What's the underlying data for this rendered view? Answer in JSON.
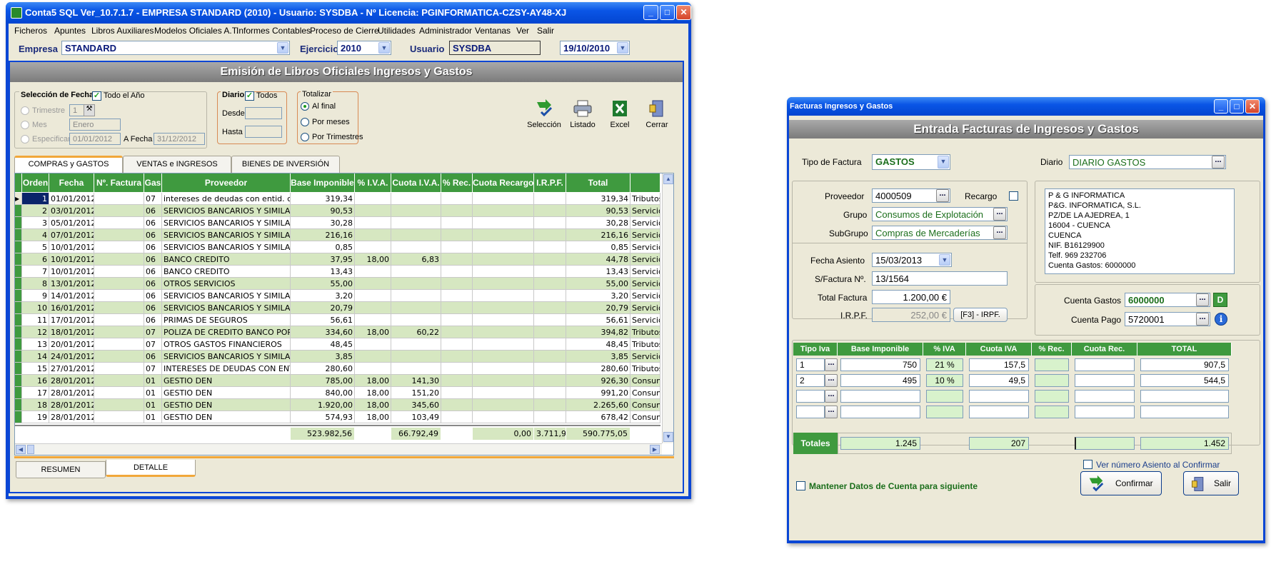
{
  "main_window": {
    "title": "Conta5 SQL Ver_10.7.1.7  -  EMPRESA STANDARD  (2010)  -   Usuario:  SYSDBA   -   Nº Licencia:  PGINFORMATICA-CZSY-AY48-XJ",
    "menu": [
      "Ficheros",
      "Apuntes",
      "Libros Auxiliares",
      "Modelos Oficiales A.T.",
      "Informes Contables",
      "Proceso de Cierre",
      "Utilidades",
      "Administrador",
      "Ventanas",
      "Ver",
      "Salir"
    ],
    "empresa_label": "Empresa",
    "empresa_value": "STANDARD",
    "ejercicio_label": "Ejercicio",
    "ejercicio_value": "2010",
    "usuario_label": "Usuario",
    "usuario_value": "SYSDBA",
    "date_value": "19/10/2010",
    "section_title": "Emisión de Libros Oficiales Ingresos y Gastos",
    "fechas": {
      "title": "Selección de Fechas",
      "todo_ano": "Todo el Año",
      "trimestre": "Trimestre",
      "trimestre_val": "1",
      "mes": "Mes",
      "mes_val": "Enero",
      "especificar": "Especificar",
      "desde_val": "01/01/2012",
      "a_fecha": "A Fecha",
      "hasta_val": "31/12/2012"
    },
    "diario": {
      "title": "Diario",
      "todos": "Todos",
      "desde": "Desde",
      "hasta": "Hasta"
    },
    "totalizar": {
      "title": "Totalizar",
      "al_final": "Al final",
      "por_meses": "Por meses",
      "por_trimestres": "Por Trimestres"
    },
    "toolbar": {
      "seleccion": "Selección",
      "listado": "Listado",
      "excel": "Excel",
      "cerrar": "Cerrar"
    },
    "tabs": [
      "COMPRAS y GASTOS",
      "VENTAS e INGRESOS",
      "BIENES DE INVERSIÓN"
    ],
    "table": {
      "headers": [
        "Orden",
        "Fecha",
        "Nº. Factura",
        "Gas",
        "Proveedor",
        "Base Imponible",
        "% I.V.A.",
        "Cuota I.V.A.",
        "% Rec.",
        "Cuota Recargo",
        "I.R.P.F.",
        "Total",
        ""
      ],
      "rows": [
        [
          "1",
          "01/01/2012",
          "",
          "07",
          "intereses de deudas con entid. cred.",
          "319,34",
          "",
          "",
          "",
          "",
          "",
          "319,34",
          "Tributos"
        ],
        [
          "2",
          "03/01/2012",
          "",
          "06",
          "SERVICIOS BANCARIOS Y SIMILARES",
          "90,53",
          "",
          "",
          "",
          "",
          "",
          "90,53",
          "Servicio"
        ],
        [
          "3",
          "05/01/2012",
          "",
          "06",
          "SERVICIOS BANCARIOS Y SIMILARES",
          "30,28",
          "",
          "",
          "",
          "",
          "",
          "30,28",
          "Servicio"
        ],
        [
          "4",
          "07/01/2012",
          "",
          "06",
          "SERVICIOS BANCARIOS Y SIMILARES",
          "216,16",
          "",
          "",
          "",
          "",
          "",
          "216,16",
          "Servicio"
        ],
        [
          "5",
          "10/01/2012",
          "",
          "06",
          "SERVICIOS BANCARIOS Y SIMILARES",
          "0,85",
          "",
          "",
          "",
          "",
          "",
          "0,85",
          "Servicio"
        ],
        [
          "6",
          "10/01/2012",
          "",
          "06",
          "BANCO CREDITO",
          "37,95",
          "18,00",
          "6,83",
          "",
          "",
          "",
          "44,78",
          "Servicio"
        ],
        [
          "7",
          "10/01/2012",
          "",
          "06",
          "BANCO CREDITO",
          "13,43",
          "",
          "",
          "",
          "",
          "",
          "13,43",
          "Servicio"
        ],
        [
          "8",
          "13/01/2012",
          "",
          "06",
          "OTROS SERVICIOS",
          "55,00",
          "",
          "",
          "",
          "",
          "",
          "55,00",
          "Servicio"
        ],
        [
          "9",
          "14/01/2012",
          "",
          "06",
          "SERVICIOS BANCARIOS Y SIMILARES",
          "3,20",
          "",
          "",
          "",
          "",
          "",
          "3,20",
          "Servicio"
        ],
        [
          "10",
          "16/01/2012",
          "",
          "06",
          "SERVICIOS BANCARIOS Y SIMILARES",
          "20,79",
          "",
          "",
          "",
          "",
          "",
          "20,79",
          "Servicio"
        ],
        [
          "11",
          "17/01/2012",
          "",
          "06",
          "PRIMAS DE SEGUROS",
          "56,61",
          "",
          "",
          "",
          "",
          "",
          "56,61",
          "Servicio"
        ],
        [
          "12",
          "18/01/2012",
          "",
          "07",
          "POLIZA DE CREDITO BANCO POPULAR",
          "334,60",
          "18,00",
          "60,22",
          "",
          "",
          "",
          "394,82",
          "Tributos"
        ],
        [
          "13",
          "20/01/2012",
          "",
          "07",
          "OTROS GASTOS FINANCIEROS",
          "48,45",
          "",
          "",
          "",
          "",
          "",
          "48,45",
          "Tributos"
        ],
        [
          "14",
          "24/01/2012",
          "",
          "06",
          "SERVICIOS BANCARIOS Y SIMILARES",
          "3,85",
          "",
          "",
          "",
          "",
          "",
          "3,85",
          "Servicio"
        ],
        [
          "15",
          "27/01/2012",
          "",
          "07",
          "INTERESES DE DEUDAS CON ENTIDADES",
          "280,60",
          "",
          "",
          "",
          "",
          "",
          "280,60",
          "Tributos"
        ],
        [
          "16",
          "28/01/2012",
          "",
          "01",
          "GESTIO DEN",
          "785,00",
          "18,00",
          "141,30",
          "",
          "",
          "",
          "926,30",
          "Consum"
        ],
        [
          "17",
          "28/01/2012",
          "",
          "01",
          "GESTIO DEN",
          "840,00",
          "18,00",
          "151,20",
          "",
          "",
          "",
          "991,20",
          "Consum"
        ],
        [
          "18",
          "28/01/2012",
          "",
          "01",
          "GESTIO DEN",
          "1.920,00",
          "18,00",
          "345,60",
          "",
          "",
          "",
          "2.265,60",
          "Consum"
        ],
        [
          "19",
          "28/01/2012",
          "",
          "01",
          "GESTIO DEN",
          "574,93",
          "18,00",
          "103,49",
          "",
          "",
          "",
          "678,42",
          "Consum"
        ]
      ],
      "totals": {
        "base": "523.982,56",
        "cuota_iva": "66.792,49",
        "cuota_recargo": "0,00",
        "irpf": "3.711,92",
        "total": "590.775,05"
      }
    },
    "bottom_tabs": [
      "RESUMEN",
      "DETALLE"
    ]
  },
  "facturas_window": {
    "title": "Facturas Ingresos y Gastos",
    "section_title": "Entrada Facturas de Ingresos y Gastos",
    "tipo_factura_label": "Tipo de Factura",
    "tipo_factura_value": "GASTOS",
    "diario_label": "Diario",
    "diario_value": "DIARIO GASTOS",
    "proveedor_label": "Proveedor",
    "proveedor_value": "4000509",
    "recargo_label": "Recargo",
    "grupo_label": "Grupo",
    "grupo_value": "Consumos de Explotación",
    "subgrupo_label": "SubGrupo",
    "subgrupo_value": "Compras de Mercaderías",
    "address": [
      "P & G INFORMATICA",
      "P&G. INFORMATICA, S.L.",
      "PZ/DE LA AJEDREA, 1",
      "16004 - CUENCA",
      "CUENCA",
      "NIF. B16129900",
      "Telf. 969 232706",
      "Cuenta Gastos: 6000000"
    ],
    "fecha_asiento_label": "Fecha Asiento",
    "fecha_asiento_value": "15/03/2013",
    "sfactura_label": "S/Factura Nº.",
    "sfactura_value": "13/1564",
    "total_factura_label": "Total Factura",
    "total_factura_value": "1.200,00 €",
    "irpf_label": "I.R.P.F.",
    "irpf_value": "252,00 €",
    "irpf_button": "[F3] - IRPF.",
    "cuenta_gastos_label": "Cuenta Gastos",
    "cuenta_gastos_value": "6000000",
    "d_button": "D",
    "cuenta_pago_label": "Cuenta Pago",
    "cuenta_pago_value": "5720001",
    "iva_table": {
      "headers": [
        "Tipo Iva",
        "Base Imponible",
        "% IVA",
        "Cuota IVA",
        "% Rec.",
        "Cuota Rec.",
        "TOTAL"
      ],
      "rows": [
        [
          "1",
          "750",
          "21 %",
          "157,5",
          "",
          "",
          "907,5"
        ],
        [
          "2",
          "495",
          "10 %",
          "49,5",
          "",
          "",
          "544,5"
        ],
        [
          "",
          "",
          "",
          "",
          "",
          "",
          ""
        ],
        [
          "",
          "",
          "",
          "",
          "",
          "",
          ""
        ]
      ],
      "totals_label": "Totales",
      "totals": {
        "base": "1.245",
        "cuota": "207",
        "total": "1.452"
      }
    },
    "ver_numero": "Ver número Asiento al Confirmar",
    "mantener": "Mantener Datos de Cuenta para siguiente",
    "confirmar": "Confirmar",
    "salir": "Salir"
  },
  "colors": {
    "xp_blue": "#0a46d5",
    "grid_green": "#3f9a3f",
    "row_alt": "#d6e7c1",
    "panel": "#ece9d8"
  }
}
